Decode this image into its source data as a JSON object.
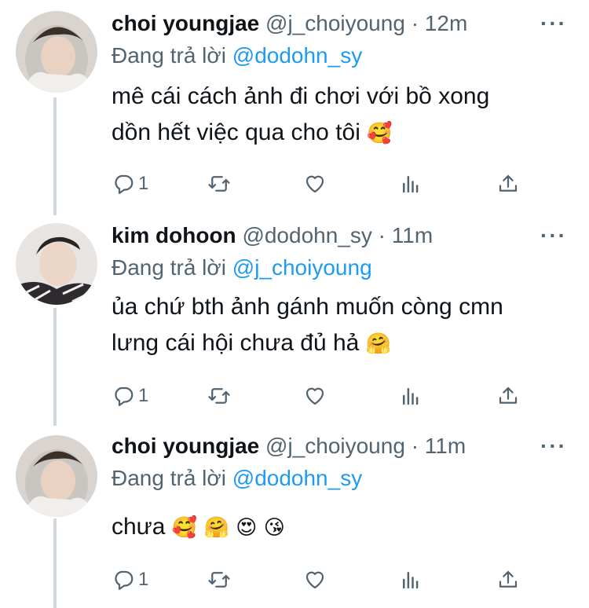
{
  "colors": {
    "accent": "#1d9bf0",
    "secondary_text": "#536471",
    "thread_line": "#cfd9de"
  },
  "tweets": [
    {
      "name": "choi youngjae",
      "handle": "@j_choiyoung",
      "dot": "·",
      "time": "12m",
      "more": "···",
      "reply_prefix": "Đang trả lời",
      "reply_to": "@dodohn_sy",
      "lines": [
        "mê cái cách ảnh đi chơi với bồ xong",
        "dồn hết việc qua cho tôi"
      ],
      "emojis": [
        "🥰"
      ],
      "reply_count": "1",
      "icons": [
        "reply-icon",
        "retweet-icon",
        "like-icon",
        "analytics-icon",
        "share-icon"
      ]
    },
    {
      "name": "kim dohoon",
      "handle": "@dodohn_sy",
      "dot": "·",
      "time": "11m",
      "more": "···",
      "reply_prefix": "Đang trả lời",
      "reply_to": "@j_choiyoung",
      "lines": [
        "ủa chứ bth ảnh gánh muốn còng cmn",
        "lưng cái hội chưa đủ hả"
      ],
      "emojis": [
        "🤗"
      ],
      "reply_count": "1",
      "icons": [
        "reply-icon",
        "retweet-icon",
        "like-icon",
        "analytics-icon",
        "share-icon"
      ]
    },
    {
      "name": "choi youngjae",
      "handle": "@j_choiyoung",
      "dot": "·",
      "time": "11m",
      "more": "···",
      "reply_prefix": "Đang trả lời",
      "reply_to": "@dodohn_sy",
      "lines": [
        "chưa"
      ],
      "emojis": [
        "🥰",
        "🤗",
        "😍",
        "😘"
      ],
      "reply_count": "1",
      "icons": [
        "reply-icon",
        "retweet-icon",
        "like-icon",
        "analytics-icon",
        "share-icon"
      ]
    }
  ]
}
